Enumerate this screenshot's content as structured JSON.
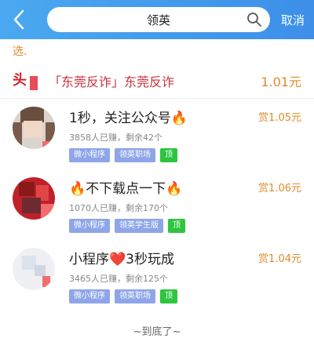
{
  "header": {
    "search_value": "领英",
    "cancel_label": "取消"
  },
  "section": {
    "tip": "选."
  },
  "promo": {
    "tou": "头",
    "title": "「东莞反诈」东莞反诈",
    "price": "1.01元"
  },
  "tasks": [
    {
      "title": "1秒，关注公众号🔥",
      "reward": "赏1.05元",
      "meta": "3858人已赚，剩余42个",
      "tags": [
        "微小程序",
        "领英职场",
        "顶"
      ]
    },
    {
      "title": "🔥不下载点一下🔥",
      "reward": "赏1.06元",
      "meta": "1070人已赚，剩余170个",
      "tags": [
        "微小程序",
        "领英学生版",
        "顶"
      ]
    },
    {
      "title": "小程序❤️3秒玩成",
      "reward": "赏1.04元",
      "meta": "3465人已赚，剩余125个",
      "tags": [
        "微小程序",
        "领英职场",
        "顶"
      ]
    }
  ],
  "footer": {
    "text": "~到底了~"
  },
  "colors": {
    "header": "#3d8fe8",
    "accent": "#e08a2a",
    "tag": "#8ea5e8",
    "tag_top": "#2dc53f",
    "promo_title": "#c9323d"
  }
}
